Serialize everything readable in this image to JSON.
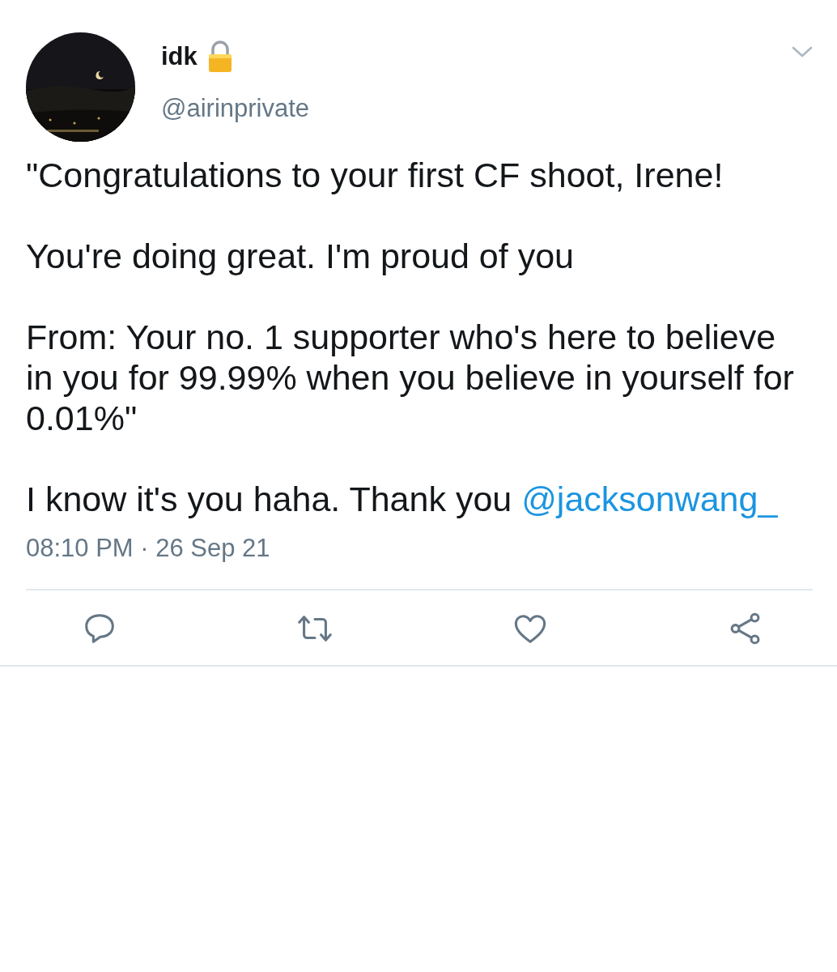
{
  "author": {
    "name": "idk",
    "protected": true,
    "handle": "@airinprivate"
  },
  "body": [
    {
      "text": "\"Congratulations to your first CF shoot, Irene!"
    },
    {
      "text": "You're doing great. I'm proud of you"
    },
    {
      "text": "From: Your no. 1 supporter who's here to believe in you for 99.99% when you believe in yourself for 0.01%\""
    },
    {
      "text": "I know it's you haha. Thank you",
      "mention": "@jacksonwang_"
    }
  ],
  "timestamp": "08:10 PM · 26 Sep 21",
  "actions": [
    {
      "kind": "reply"
    },
    {
      "kind": "retweet"
    },
    {
      "kind": "like"
    },
    {
      "kind": "share"
    }
  ]
}
